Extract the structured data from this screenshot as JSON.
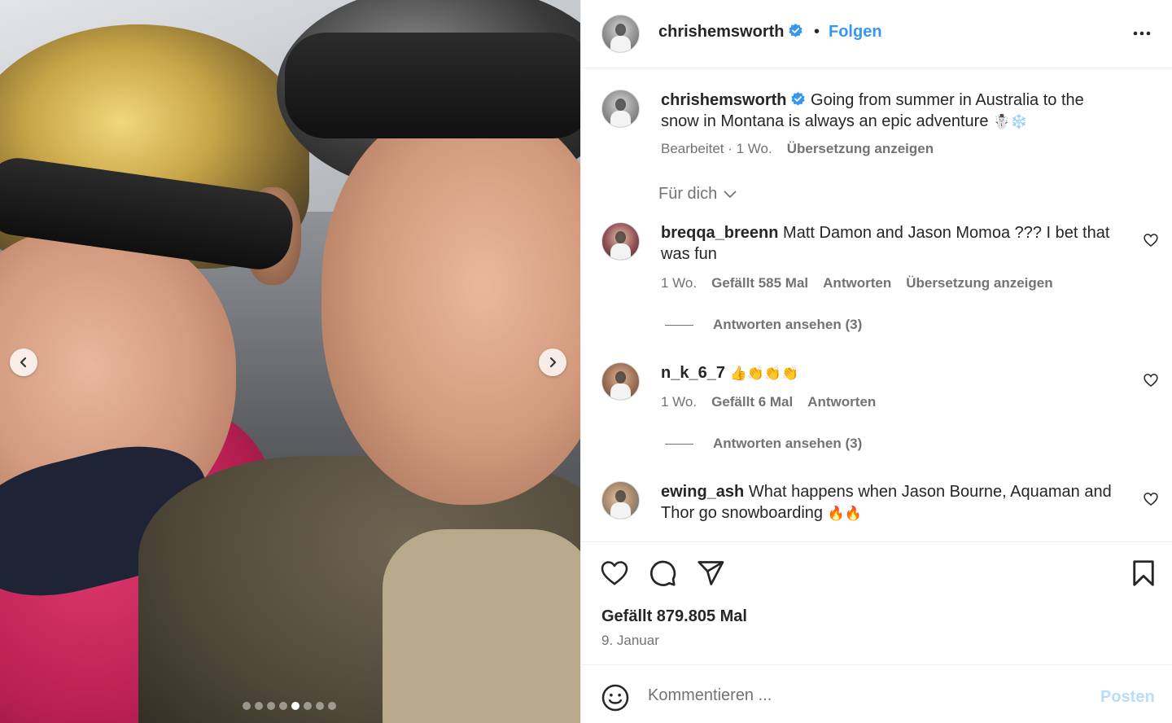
{
  "post": {
    "username": "chrishemsworth",
    "follow_label": "Folgen",
    "separator": "•",
    "image_dots_count": 8,
    "image_dots_active": 5
  },
  "caption": {
    "username": "chrishemsworth",
    "text": "Going from summer in Australia to the snow in Montana is always an epic adventure",
    "emoji": "☃️❄️",
    "edited": "Bearbeitet · 1 Wo.",
    "translate": "Übersetzung anzeigen"
  },
  "filter": {
    "label": "Für dich"
  },
  "comments": [
    {
      "username": "breqqa_breenn",
      "text": "Matt Damon and Jason Momoa ??? I bet that was fun",
      "time": "1 Wo.",
      "likes": "Gefällt 585 Mal",
      "reply": "Antworten",
      "translate": "Übersetzung anzeigen",
      "view_replies": "Antworten ansehen (3)"
    },
    {
      "username": "n_k_6_7",
      "text": "",
      "emoji": "👍👏👏👏",
      "time": "1 Wo.",
      "likes": "Gefällt 6 Mal",
      "reply": "Antworten",
      "view_replies": "Antworten ansehen (3)"
    },
    {
      "username": "ewing_ash",
      "text": "What happens when Jason Bourne, Aquaman and Thor go snowboarding",
      "emoji": "🔥🔥"
    }
  ],
  "footer": {
    "likes": "Gefällt 879.805 Mal",
    "date": "9. Januar",
    "comment_placeholder": "Kommentieren ...",
    "post_label": "Posten"
  },
  "colors": {
    "link_blue": "#3797f0",
    "muted": "#737373",
    "text": "#262626",
    "post_disabled": "#b8dcfb"
  }
}
